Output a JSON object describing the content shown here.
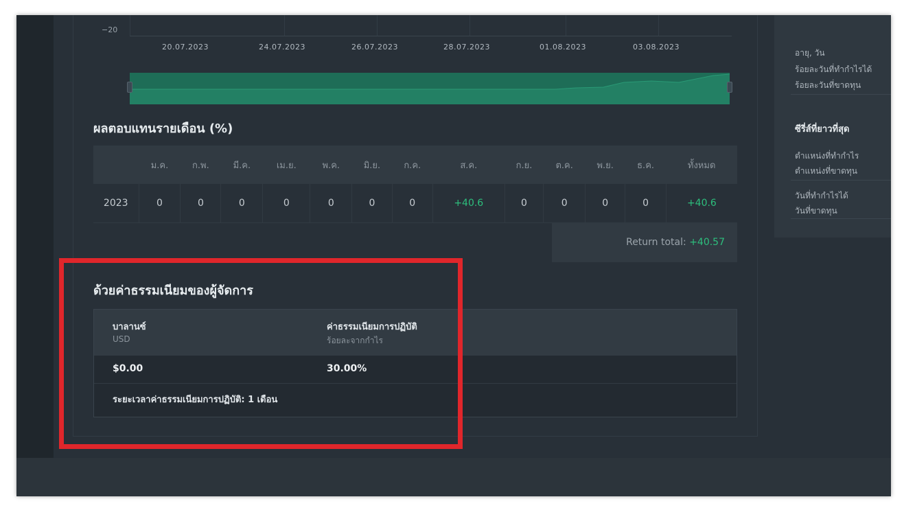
{
  "chart": {
    "y_tick": "−20",
    "x_ticks": [
      "20.07.2023",
      "24.07.2023",
      "26.07.2023",
      "28.07.2023",
      "01.08.2023",
      "03.08.2023"
    ]
  },
  "monthly_returns": {
    "title": "ผลตอบแทนรายเดือน (%)",
    "headers": [
      "",
      "ม.ค.",
      "ก.พ.",
      "มี.ค.",
      "เม.ย.",
      "พ.ค.",
      "มิ.ย.",
      "ก.ค.",
      "ส.ค.",
      "ก.ย.",
      "ต.ค.",
      "พ.ย.",
      "ธ.ค.",
      "ทั้งหมด"
    ],
    "rows": [
      {
        "cells": [
          "2023",
          "0",
          "0",
          "0",
          "0",
          "0",
          "0",
          "0",
          "+40.6",
          "0",
          "0",
          "0",
          "0",
          "+40.6"
        ]
      }
    ],
    "return_total_label": "Return total:",
    "return_total_value": "+40.57"
  },
  "manager_fee": {
    "title": "ด้วยค่าธรรมเนียมของผู้จัดการ",
    "balance_label": "บาลานซ์",
    "balance_sub": "USD",
    "performance_fee_label": "ค่าธรรมเนียมการปฏิบัติ",
    "performance_fee_sub": "ร้อยละจากกำไร",
    "balance_value": "$0.00",
    "performance_fee_value": "30.00%",
    "period_text": "ระยะเวลาค่าธรรมเนียมการปฏิบัติ: 1 เดือน"
  },
  "sidebar": {
    "age_label": "อายุ, วัน",
    "profit_days_pct": "ร้อยละวันที่ทำกำไรได้",
    "loss_days_pct": "ร้อยละวันที่ขาดทุน",
    "longest_series_title": "ซีรี่ส์ที่ยาวที่สุด",
    "profit_positions": "ตำแหน่งที่ทำกำไร",
    "loss_positions": "ตำแหน่งที่ขาดทุน",
    "profit_days": "วันที่ทำกำไรได้",
    "loss_days": "วันที่ขาดทุน"
  },
  "colors": {
    "positive": "#2dbf7d",
    "highlight": "#e0262b",
    "navigator": "#1f6f58"
  }
}
